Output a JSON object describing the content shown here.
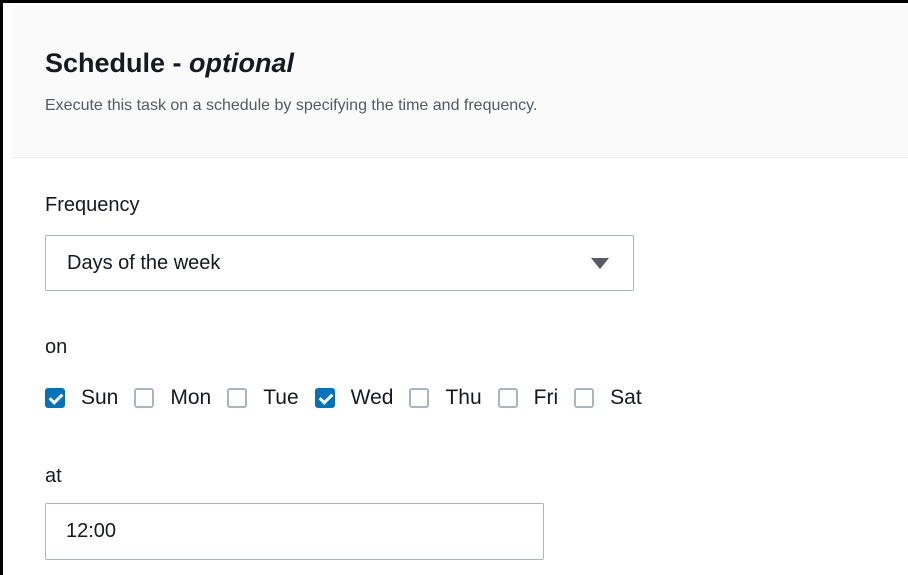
{
  "header": {
    "title": "Schedule - ",
    "title_optional": "optional",
    "description": "Execute this task on a schedule by specifying the time and frequency."
  },
  "frequency": {
    "label": "Frequency",
    "selected": "Days of the week"
  },
  "days_section": {
    "label": "on",
    "days": [
      {
        "label": "Sun",
        "checked": true
      },
      {
        "label": "Mon",
        "checked": false
      },
      {
        "label": "Tue",
        "checked": false
      },
      {
        "label": "Wed",
        "checked": true
      },
      {
        "label": "Thu",
        "checked": false
      },
      {
        "label": "Fri",
        "checked": false
      },
      {
        "label": "Sat",
        "checked": false
      }
    ]
  },
  "time": {
    "label": "at",
    "value": "12:00"
  },
  "colors": {
    "accent": "#0073bb",
    "border": "#aab7b8",
    "text": "#16191f",
    "muted_text": "#545b64",
    "header_bg": "#fafafa"
  }
}
